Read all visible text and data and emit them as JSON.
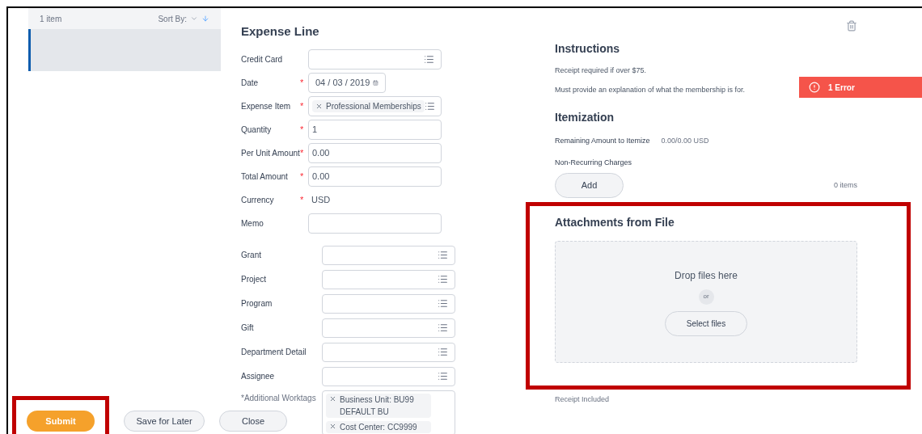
{
  "list": {
    "count": "1 item",
    "sort_label": "Sort By:",
    "rows": [
      {
        "selected": true
      }
    ]
  },
  "form": {
    "title": "Expense Line",
    "fields": [
      {
        "label": "Credit Card",
        "kind": "select"
      },
      {
        "label": "Date",
        "required_mark": "*",
        "kind": "date",
        "value": "04 / 03 / 2019"
      },
      {
        "label": "Expense Item",
        "required_mark": "*",
        "kind": "tag",
        "value": "Professional Memberships"
      },
      {
        "label": "Quantity",
        "required_mark": "*",
        "kind": "text",
        "value": "1"
      },
      {
        "label": "Per Unit Amount",
        "required_mark": "*",
        "kind": "text",
        "value": "0.00"
      },
      {
        "label": "Total Amount",
        "required_mark": "*",
        "kind": "text",
        "value": "0.00"
      },
      {
        "label": "Currency",
        "required_mark": "*",
        "kind": "static",
        "value": "USD"
      },
      {
        "label": "Memo",
        "kind": "text"
      }
    ],
    "worktag_fields": [
      {
        "label": "Grant"
      },
      {
        "label": "Project"
      },
      {
        "label": "Program"
      },
      {
        "label": "Gift"
      },
      {
        "label": "Department Detail"
      },
      {
        "label": "Assignee"
      }
    ],
    "additional_worktags": {
      "label": "*Additional Worktags",
      "tags": [
        "Business Unit: BU99 DEFAULT BU",
        "Cost Center: CC9999"
      ]
    }
  },
  "instructions": {
    "title": "Instructions",
    "lines": [
      "Receipt required if over $75.",
      "Must provide an explanation of what the membership is for."
    ]
  },
  "error_banner": {
    "text": "1 Error"
  },
  "itemization": {
    "title": "Itemization",
    "remaining_label": "Remaining Amount to Itemize",
    "remaining_value": "0.00/0.00 USD",
    "charges_label": "Non-Recurring Charges",
    "add_button": "Add",
    "items_count": "0 items"
  },
  "attachments": {
    "title": "Attachments from File",
    "highlighted": true,
    "drop_text": "Drop files here",
    "or_text": "or",
    "select_button": "Select files"
  },
  "receipt_label": "Receipt Included",
  "footer": {
    "buttons": [
      {
        "label": "Submit",
        "kind": "primary",
        "highlighted": true
      },
      {
        "label": "Save for Later",
        "kind": "secondary",
        "highlighted": false
      },
      {
        "label": "Close",
        "kind": "secondary",
        "highlighted": false
      }
    ]
  }
}
